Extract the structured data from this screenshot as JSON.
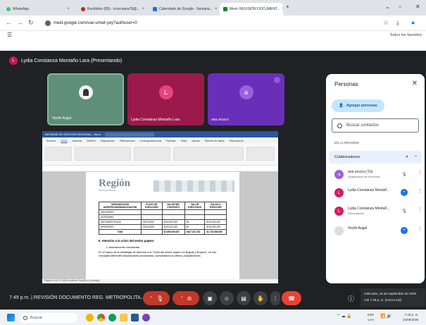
{
  "browser": {
    "tabs": [
      {
        "label": "WhatsApp",
        "color": "#25d366"
      },
      {
        "label": "Recibidos (83) - crozcoana79@...",
        "color": "#c5221f"
      },
      {
        "label": "Calendario de Google - Semana...",
        "color": "#1a73e8"
      },
      {
        "label": "Meet: REVISIÓN DOCUMENT...",
        "color": "#00832d"
      }
    ],
    "url": "meet.google.com/vue-umwt-yey?authuser=0",
    "bookmark": "Todos los favoritos"
  },
  "meet": {
    "presenter_label": "Lydia Constanza Montaño Lara (Presentando)",
    "presenter_initial": "L",
    "tiles": [
      {
        "name": "Yecith Angel",
        "initial": "",
        "bg": "#5f8f78",
        "avatar_bg": "#f1f3f4"
      },
      {
        "name": "Lydia Constanza Montaño Lara",
        "initial": "L",
        "bg": "#9c1a4b",
        "avatar_bg": "#e8457c"
      },
      {
        "name": "ana orozco",
        "initial": "a",
        "bg": "#6a2fb8",
        "avatar_bg": "#9b61e0"
      }
    ],
    "meeting_time": "7:49 p.m.",
    "meeting_title": "REVISIÓN DOCUMENTO REG. METROPOLITA...",
    "tooltip_line1": "miércoles, 24 de septiembre de 2025",
    "tooltip_line2": "mié 7:49 p. m. (Hora local)"
  },
  "shared_doc": {
    "window_title": "INFORME DE GESTIÓN REGIONAL - Word",
    "search_hint": "Buscar",
    "menu": [
      "Archivo",
      "Inicio",
      "Insertar",
      "Diseño",
      "Disposición",
      "Referencias",
      "Correspondencia",
      "Revisar",
      "Vista",
      "Ayuda",
      "Diseño de tabla",
      "Disposición"
    ],
    "logo": "Región",
    "logo_sub": "Metropolitana",
    "table_headers": [
      "ORGANIZACIÓN AGROPECUARIA/ASOCIACIÓN",
      "PLAZO DE EJECUCIÓN",
      "VALOR DEL CONTRATO",
      "VALOR EJECUTADO",
      "SALDO A EJECUTAR"
    ],
    "table_rows": [
      [
        "SAN ISIDRO",
        "",
        "",
        "",
        ""
      ],
      [
        "AGROSANO",
        "",
        "",
        "",
        ""
      ],
      [
        "ASOCAMPOTUNJA",
        "30/11/2025",
        "$100.000.000",
        "$0",
        "$100.000.000"
      ],
      [
        "APROAGRO",
        "30/11/2025",
        "$100.000.000",
        "$0",
        "$100.000.000"
      ]
    ],
    "total_label": "Total",
    "total_values": [
      "$2.895.000.000",
      "$817.222.781",
      "$1.718.656.896"
    ],
    "section_heading": "II. Atención a la crisis del sector papero",
    "subsection": "1. Asociaciones vinculadas:",
    "paragraph": "En el marco de la estrategia de atención a la \"Crisis del sector papero en Bogotá y Boyacá\", se han vinculado diferentes Asociaciones productoras, consolidando la oferta y adquisiciones:",
    "status_bar": "Página 8 de 13    5165 palabras    Español (Colombia)"
  },
  "people_panel": {
    "title": "Personas",
    "add_label": "Agregar personas",
    "search_placeholder": "Buscar contactos",
    "section_label": "EN LA REUNIÓN",
    "collaborators_label": "Colaboradores",
    "collaborators_count": "4",
    "people": [
      {
        "name": "ana orozco (Tú)",
        "sub": "Organizador de la reunión",
        "initial": "a",
        "color": "#9b61e0"
      },
      {
        "name": "Lydia Constanza Montañ...",
        "sub": "",
        "initial": "L",
        "color": "#d81b60"
      },
      {
        "name": "Lydia Constanza Montañ...",
        "sub": "Presentación",
        "initial": "L",
        "color": "#d81b60"
      },
      {
        "name": "Yecith Angel",
        "sub": "",
        "initial": "",
        "color": "#dadce0"
      }
    ]
  },
  "taskbar": {
    "search_label": "Buscar",
    "lang": "ESP",
    "lang2": "LAA",
    "clock_time": "7:49 p. m.",
    "clock_date": "24/09/2025"
  }
}
